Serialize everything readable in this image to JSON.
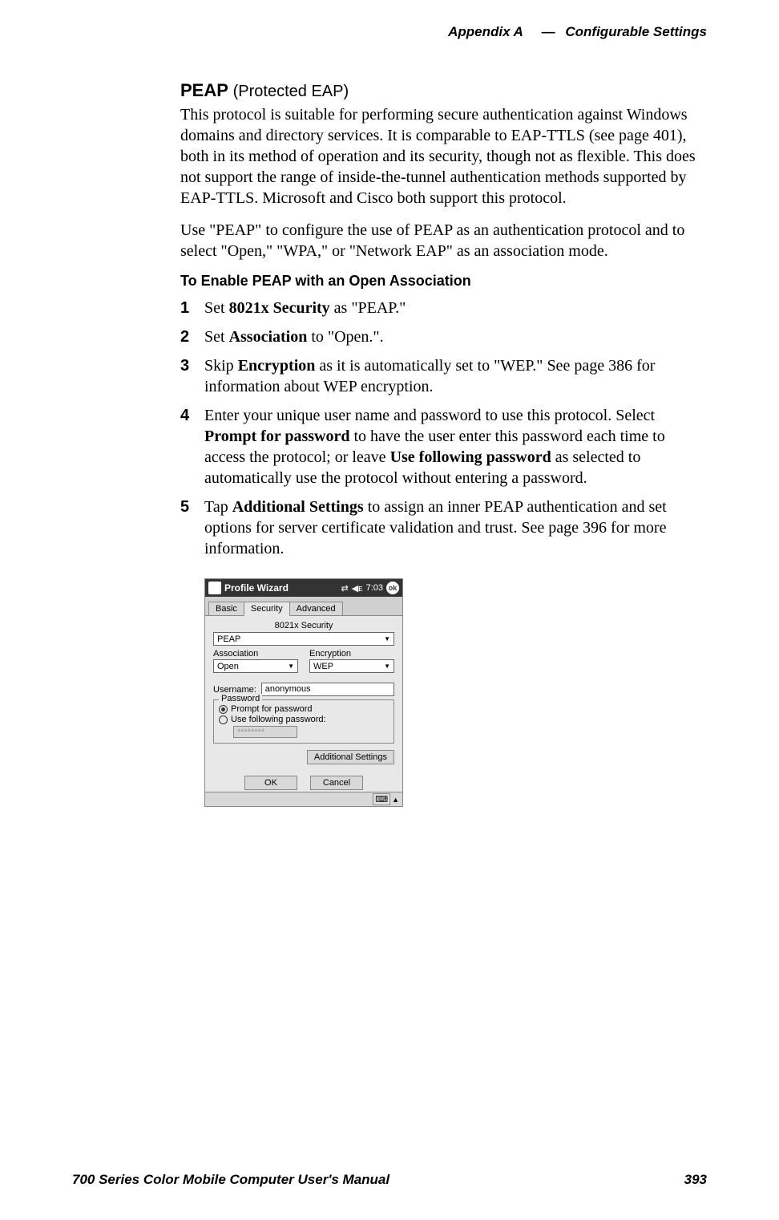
{
  "header": {
    "appendix": "Appendix A",
    "dash": "—",
    "title": "Configurable Settings"
  },
  "section": {
    "title": "PEAP",
    "subtitle": "(Protected EAP)"
  },
  "paragraphs": {
    "p1": "This protocol is suitable for performing secure authentication against Windows domains and directory services. It is comparable to EAP-TTLS (see page 401), both in its method of operation and its security, though not as flexible. This does not support the range of inside-the-tunnel authentication methods supported by EAP-TTLS. Microsoft and Cisco both support this protocol.",
    "p2": "Use \"PEAP\" to configure the use of PEAP as an authentication protocol and to select \"Open,\" \"WPA,\" or \"Network EAP\" as an association mode."
  },
  "subsection": {
    "title": "To Enable PEAP with an Open Association"
  },
  "steps": {
    "s1_pre": "Set ",
    "s1_bold": "8021x Security",
    "s1_post": " as \"PEAP.\"",
    "s2_pre": "Set ",
    "s2_bold": "Association",
    "s2_post": " to \"Open.\".",
    "s3_pre": "Skip ",
    "s3_bold": "Encryption",
    "s3_post": " as it is automatically set to \"WEP.\" See page 386 for information about WEP encryption.",
    "s4_pre": "Enter your unique user name and password to use this protocol. Select ",
    "s4_bold1": "Prompt for password",
    "s4_mid": " to have the user enter this password each time to access the protocol; or leave ",
    "s4_bold2": "Use following password",
    "s4_post": " as selected to automatically use the protocol without entering a password.",
    "s5_pre": "Tap ",
    "s5_bold": "Additional Settings",
    "s5_post": " to assign an inner PEAP authentication and set options for server certificate validation and trust. See page 396 for more information."
  },
  "screenshot": {
    "titlebar": {
      "title": "Profile Wizard",
      "time": "7:03",
      "ok": "ok"
    },
    "tabs": {
      "basic": "Basic",
      "security": "Security",
      "advanced": "Advanced"
    },
    "labels": {
      "security8021x": "8021x Security",
      "association": "Association",
      "encryption": "Encryption",
      "username": "Username:",
      "password": "Password"
    },
    "values": {
      "security": "PEAP",
      "association": "Open",
      "encryption": "WEP",
      "username": "anonymous",
      "password_masked": "********"
    },
    "radios": {
      "prompt": "Prompt for password",
      "usefollowing": "Use following password:"
    },
    "buttons": {
      "additional": "Additional Settings",
      "ok": "OK",
      "cancel": "Cancel"
    }
  },
  "footer": {
    "manual": "700 Series Color Mobile Computer User's Manual",
    "page": "393"
  }
}
